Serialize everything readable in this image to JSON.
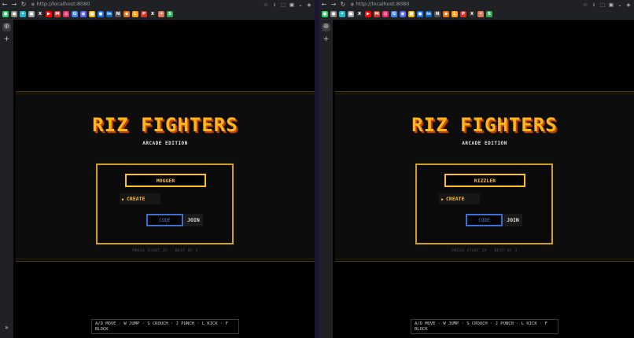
{
  "browser": {
    "url": "http://localhost:8080",
    "nav": {
      "back": "←",
      "forward": "→",
      "reload": "↻"
    },
    "toolbar_icons": [
      "star-icon",
      "download-icon",
      "extensions-icon",
      "wallet-icon",
      "profile-icon",
      "menu-icon"
    ],
    "toolbar_glyphs": [
      "☆",
      "⭳",
      "⬚",
      "▣",
      "⌄",
      "◈"
    ],
    "bookmarks": [
      {
        "icon": "whatsapp-icon",
        "glyph": "●",
        "color": "#25d366"
      },
      {
        "icon": "chrome-icon",
        "glyph": "●",
        "color": "#888888"
      },
      {
        "icon": "perplexity-icon",
        "glyph": "✦",
        "color": "#20b8cd"
      },
      {
        "icon": "github-icon",
        "glyph": "●",
        "color": "#9aa0a6"
      },
      {
        "icon": "x-icon",
        "glyph": "X",
        "color": "#2b2b2b"
      },
      {
        "icon": "youtube-icon",
        "glyph": "▶",
        "color": "#ff0000"
      },
      {
        "icon": "gmail-icon",
        "glyph": "M",
        "color": "#d93025"
      },
      {
        "icon": "instagram-icon",
        "glyph": "◎",
        "color": "#e1306c"
      },
      {
        "icon": "google-icon",
        "glyph": "G",
        "color": "#4285f4"
      },
      {
        "icon": "discord-icon",
        "glyph": "◉",
        "color": "#5865f2"
      },
      {
        "icon": "folder-icon",
        "glyph": "■",
        "color": "#f4b400"
      },
      {
        "icon": "chrome-icon",
        "glyph": "●",
        "color": "#1a73e8"
      },
      {
        "icon": "linkedin-icon",
        "glyph": "in",
        "color": "#0a66c2"
      },
      {
        "icon": "notion-icon",
        "glyph": "N",
        "color": "#555555"
      },
      {
        "icon": "ide-icon",
        "glyph": "◆",
        "color": "#e8710a"
      },
      {
        "icon": "leetcode-icon",
        "glyph": "L",
        "color": "#ffa116"
      },
      {
        "icon": "pdf-icon",
        "glyph": "P",
        "color": "#d93025"
      },
      {
        "icon": "x-icon",
        "glyph": "X",
        "color": "#2b2b2b"
      },
      {
        "icon": "claude-icon",
        "glyph": "✳",
        "color": "#d97757"
      },
      {
        "icon": "site-icon",
        "glyph": "S",
        "color": "#34a853"
      }
    ],
    "sidebar": {
      "top_icon": "⊕",
      "add": "+",
      "expand": "»"
    }
  },
  "left": {
    "game": {
      "title": "RIZ FIGHTERS",
      "subtitle": "ARCADE EDITION",
      "player_name": "MOGGER",
      "create_label": "CREATE",
      "create_arrow": "▶",
      "code_placeholder": "CODE",
      "join_label": "JOIN",
      "hint": "PRESS START 2P · BEST OF 3",
      "controls": "A/D MOVE · W JUMP · S CROUCH · J PUNCH · L KICK · F BLOCK"
    }
  },
  "right": {
    "game": {
      "title": "RIZ FIGHTERS",
      "subtitle": "ARCADE EDITION",
      "player_name": "RIZZLER",
      "create_label": "CREATE",
      "create_arrow": "▶",
      "code_placeholder": "CODE",
      "join_label": "JOIN",
      "hint": "PRESS START 2P · BEST OF 3",
      "controls": "A/D MOVE · W JUMP · S CROUCH · J PUNCH · L KICK · F BLOCK"
    }
  },
  "colors": {
    "title": "#ffb81c",
    "title_shadow": "#c2410c",
    "panel_border": "#d4a017",
    "code_border": "#3b6fd4"
  }
}
